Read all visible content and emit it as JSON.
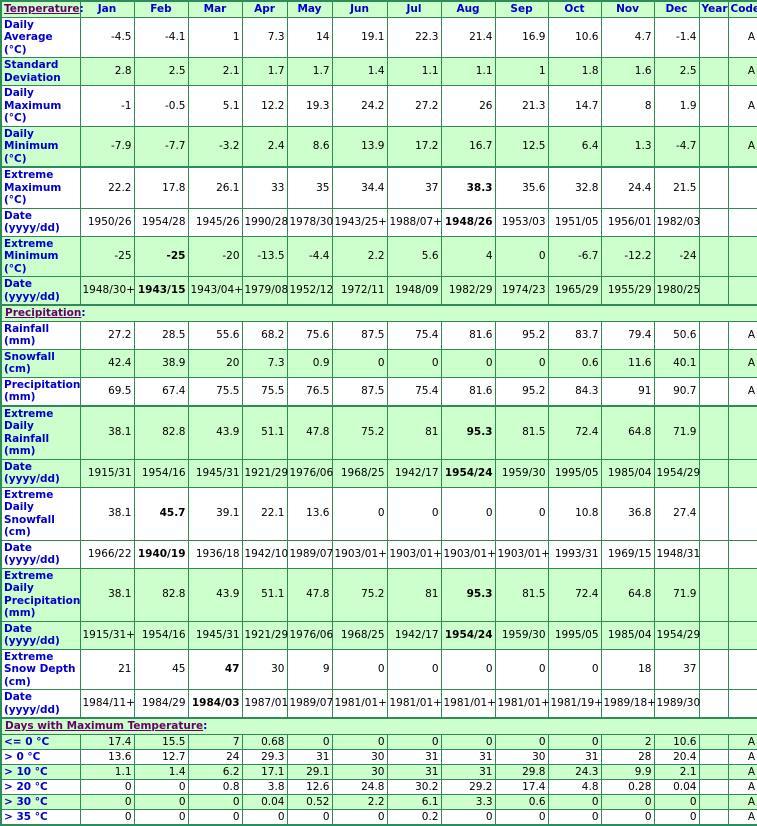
{
  "header": {
    "section_title": "Temperature",
    "colon": ":",
    "columns": [
      "Jan",
      "Feb",
      "Mar",
      "Apr",
      "May",
      "Jun",
      "Jul",
      "Aug",
      "Sep",
      "Oct",
      "Nov",
      "Dec",
      "Year",
      "Code"
    ]
  },
  "temperature_rows": [
    {
      "label": "Daily Average (°C)",
      "values": [
        "-4.5",
        "-4.1",
        "1",
        "7.3",
        "14",
        "19.1",
        "22.3",
        "21.4",
        "16.9",
        "10.6",
        "4.7",
        "-1.4",
        "",
        "A"
      ],
      "bold": []
    },
    {
      "label": "Standard Deviation",
      "values": [
        "2.8",
        "2.5",
        "2.1",
        "1.7",
        "1.7",
        "1.4",
        "1.1",
        "1.1",
        "1",
        "1.8",
        "1.6",
        "2.5",
        "",
        "A"
      ],
      "bold": []
    },
    {
      "label": "Daily Maximum (°C)",
      "values": [
        "-1",
        "-0.5",
        "5.1",
        "12.2",
        "19.3",
        "24.2",
        "27.2",
        "26",
        "21.3",
        "14.7",
        "8",
        "1.9",
        "",
        "A"
      ],
      "bold": []
    },
    {
      "label": "Daily Minimum (°C)",
      "values": [
        "-7.9",
        "-7.7",
        "-3.2",
        "2.4",
        "8.6",
        "13.9",
        "17.2",
        "16.7",
        "12.5",
        "6.4",
        "1.3",
        "-4.7",
        "",
        "A"
      ],
      "bold": []
    },
    {
      "label": "Extreme Maximum (°C)",
      "values": [
        "22.2",
        "17.8",
        "26.1",
        "33",
        "35",
        "34.4",
        "37",
        "38.3",
        "35.6",
        "32.8",
        "24.4",
        "21.5",
        "",
        ""
      ],
      "bold": [
        7
      ]
    },
    {
      "label": "Date (yyyy/dd)",
      "values": [
        "1950/26",
        "1954/28",
        "1945/26",
        "1990/28",
        "1978/30",
        "1943/25+",
        "1988/07+",
        "1948/26",
        "1953/03",
        "1951/05",
        "1956/01",
        "1982/03",
        "",
        ""
      ],
      "bold": [
        7
      ]
    },
    {
      "label": "Extreme Minimum (°C)",
      "values": [
        "-25",
        "-25",
        "-20",
        "-13.5",
        "-4.4",
        "2.2",
        "5.6",
        "4",
        "0",
        "-6.7",
        "-12.2",
        "-24",
        "",
        ""
      ],
      "bold": [
        1
      ]
    },
    {
      "label": "Date (yyyy/dd)",
      "values": [
        "1948/30+",
        "1943/15",
        "1943/04+",
        "1979/08",
        "1952/12",
        "1972/11",
        "1948/09",
        "1982/29",
        "1974/23",
        "1965/29",
        "1955/29",
        "1980/25",
        "",
        ""
      ],
      "bold": [
        1
      ]
    }
  ],
  "precipitation": {
    "section_title": "Precipitation",
    "colon": ":",
    "rows": [
      {
        "label": "Rainfall (mm)",
        "values": [
          "27.2",
          "28.5",
          "55.6",
          "68.2",
          "75.6",
          "87.5",
          "75.4",
          "81.6",
          "95.2",
          "83.7",
          "79.4",
          "50.6",
          "",
          "A"
        ],
        "bold": []
      },
      {
        "label": "Snowfall (cm)",
        "values": [
          "42.4",
          "38.9",
          "20",
          "7.3",
          "0.9",
          "0",
          "0",
          "0",
          "0",
          "0.6",
          "11.6",
          "40.1",
          "",
          "A"
        ],
        "bold": []
      },
      {
        "label": "Precipitation (mm)",
        "values": [
          "69.5",
          "67.4",
          "75.5",
          "75.5",
          "76.5",
          "87.5",
          "75.4",
          "81.6",
          "95.2",
          "84.3",
          "91",
          "90.7",
          "",
          "A"
        ],
        "bold": []
      },
      {
        "label": "Extreme Daily Rainfall (mm)",
        "values": [
          "38.1",
          "82.8",
          "43.9",
          "51.1",
          "47.8",
          "75.2",
          "81",
          "95.3",
          "81.5",
          "72.4",
          "64.8",
          "71.9",
          "",
          ""
        ],
        "bold": [
          7
        ]
      },
      {
        "label": "Date (yyyy/dd)",
        "values": [
          "1915/31",
          "1954/16",
          "1945/31",
          "1921/29",
          "1976/06",
          "1968/25",
          "1942/17",
          "1954/24",
          "1959/30",
          "1995/05",
          "1985/04",
          "1954/29",
          "",
          ""
        ],
        "bold": [
          7
        ]
      },
      {
        "label": "Extreme Daily Snowfall (cm)",
        "values": [
          "38.1",
          "45.7",
          "39.1",
          "22.1",
          "13.6",
          "0",
          "0",
          "0",
          "0",
          "10.8",
          "36.8",
          "27.4",
          "",
          ""
        ],
        "bold": [
          1
        ]
      },
      {
        "label": "Date (yyyy/dd)",
        "values": [
          "1966/22",
          "1940/19",
          "1936/18",
          "1942/10",
          "1989/07",
          "1903/01+",
          "1903/01+",
          "1903/01+",
          "1903/01+",
          "1993/31",
          "1969/15",
          "1948/31",
          "",
          ""
        ],
        "bold": [
          1
        ]
      },
      {
        "label": "Extreme Daily Precipitation (mm)",
        "values": [
          "38.1",
          "82.8",
          "43.9",
          "51.1",
          "47.8",
          "75.2",
          "81",
          "95.3",
          "81.5",
          "72.4",
          "64.8",
          "71.9",
          "",
          ""
        ],
        "bold": [
          7
        ]
      },
      {
        "label": "Date (yyyy/dd)",
        "values": [
          "1915/31+",
          "1954/16",
          "1945/31",
          "1921/29",
          "1976/06",
          "1968/25",
          "1942/17",
          "1954/24",
          "1959/30",
          "1995/05",
          "1985/04",
          "1954/29",
          "",
          ""
        ],
        "bold": [
          7
        ]
      },
      {
        "label": "Extreme Snow Depth (cm)",
        "values": [
          "21",
          "45",
          "47",
          "30",
          "9",
          "0",
          "0",
          "0",
          "0",
          "0",
          "18",
          "37",
          "",
          ""
        ],
        "bold": [
          2
        ]
      },
      {
        "label": "Date (yyyy/dd)",
        "values": [
          "1984/11+",
          "1984/29",
          "1984/03",
          "1987/01",
          "1989/07",
          "1981/01+",
          "1981/01+",
          "1981/01+",
          "1981/01+",
          "1981/19+",
          "1989/18+",
          "1989/30",
          "",
          ""
        ],
        "bold": [
          2
        ]
      }
    ]
  },
  "days_max_temp": {
    "section_title": "Days with Maximum Temperature",
    "colon": ":",
    "rows": [
      {
        "label": "<= 0 °C",
        "values": [
          "17.4",
          "15.5",
          "7",
          "0.68",
          "0",
          "0",
          "0",
          "0",
          "0",
          "0",
          "2",
          "10.6",
          "",
          "A"
        ],
        "bold": []
      },
      {
        "label": "> 0 °C",
        "values": [
          "13.6",
          "12.7",
          "24",
          "29.3",
          "31",
          "30",
          "31",
          "31",
          "30",
          "31",
          "28",
          "20.4",
          "",
          "A"
        ],
        "bold": []
      },
      {
        "label": "> 10 °C",
        "values": [
          "1.1",
          "1.4",
          "6.2",
          "17.1",
          "29.1",
          "30",
          "31",
          "31",
          "29.8",
          "24.3",
          "9.9",
          "2.1",
          "",
          "A"
        ],
        "bold": []
      },
      {
        "label": "> 20 °C",
        "values": [
          "0",
          "0",
          "0.8",
          "3.8",
          "12.6",
          "24.8",
          "30.2",
          "29.2",
          "17.4",
          "4.8",
          "0.28",
          "0.04",
          "",
          "A"
        ],
        "bold": []
      },
      {
        "label": "> 30 °C",
        "values": [
          "0",
          "0",
          "0",
          "0.04",
          "0.52",
          "2.2",
          "6.1",
          "3.3",
          "0.6",
          "0",
          "0",
          "0",
          "",
          "A"
        ],
        "bold": []
      },
      {
        "label": "> 35 °C",
        "values": [
          "0",
          "0",
          "0",
          "0",
          "0",
          "0",
          "0.2",
          "0",
          "0",
          "0",
          "0",
          "0",
          "",
          "A"
        ],
        "bold": []
      }
    ]
  }
}
